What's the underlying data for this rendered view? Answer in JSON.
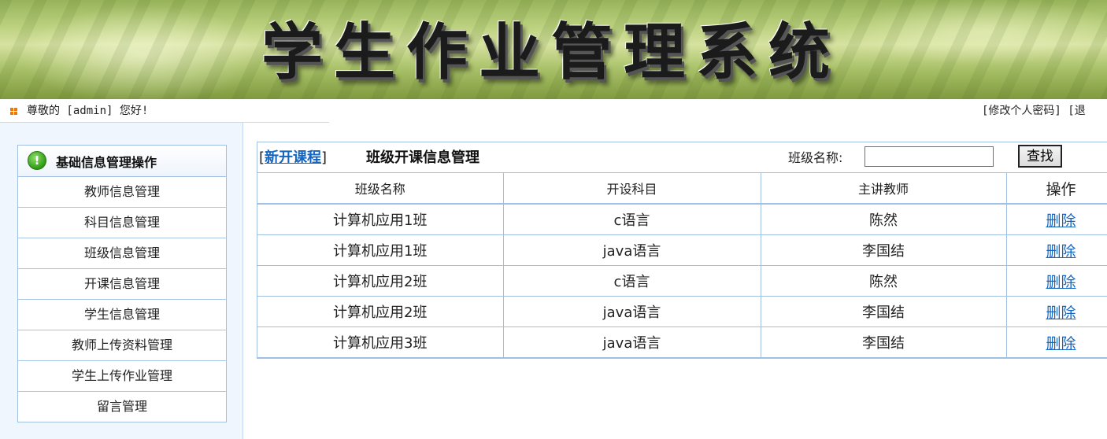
{
  "banner": {
    "title": "学生作业管理系统"
  },
  "infobar": {
    "greeting": "尊敬的 [admin] 您好!",
    "change_password": "[修改个人密码]",
    "logout": "[退"
  },
  "sidebar": {
    "heading": "基础信息管理操作",
    "items": [
      {
        "label": "教师信息管理"
      },
      {
        "label": "科目信息管理"
      },
      {
        "label": "班级信息管理"
      },
      {
        "label": "开课信息管理"
      },
      {
        "label": "学生信息管理"
      },
      {
        "label": "教师上传资料管理"
      },
      {
        "label": "学生上传作业管理"
      },
      {
        "label": "留言管理"
      }
    ]
  },
  "main": {
    "bracket_open": "[",
    "new_course_link": "新开课程",
    "bracket_close": "]",
    "title": "班级开课信息管理",
    "filter_label": "班级名称:",
    "filter_value": "",
    "search_button": "查找",
    "columns": [
      "班级名称",
      "开设科目",
      "主讲教师",
      "操作"
    ],
    "rows": [
      {
        "class": "计算机应用1班",
        "subject": "c语言",
        "teacher": "陈然",
        "action": "删除"
      },
      {
        "class": "计算机应用1班",
        "subject": "java语言",
        "teacher": "李国结",
        "action": "删除"
      },
      {
        "class": "计算机应用2班",
        "subject": "c语言",
        "teacher": "陈然",
        "action": "删除"
      },
      {
        "class": "计算机应用2班",
        "subject": "java语言",
        "teacher": "李国结",
        "action": "删除"
      },
      {
        "class": "计算机应用3班",
        "subject": "java语言",
        "teacher": "李国结",
        "action": "删除"
      }
    ]
  },
  "colors": {
    "link": "#1565c0",
    "border": "#9fbfe3",
    "sidebar_bg": "#f0f6fd",
    "bullet": "#f07800"
  }
}
